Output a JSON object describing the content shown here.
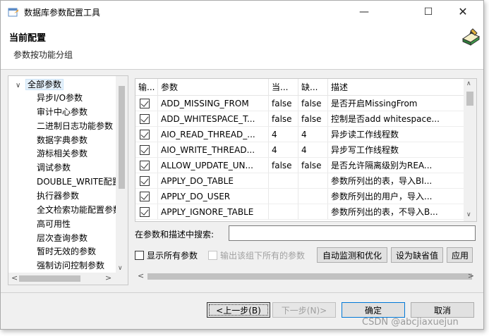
{
  "window": {
    "title": "数据库参数配置工具",
    "controls": {
      "minimize": "—",
      "maximize": "☐",
      "close": "✕"
    }
  },
  "header": {
    "title": "当前配置",
    "subtitle": "参数按功能分组"
  },
  "tree": {
    "root": "全部参数",
    "items": [
      "异步I/O参数",
      "审计中心参数",
      "二进制日志功能参数",
      "数据字典参数",
      "游标相关参数",
      "调试参数",
      "DOUBLE_WRITE配置",
      "执行器参数",
      "全文检索功能配置参数",
      "高可用性",
      "层次查询参数",
      "暂时无效的参数",
      "强制访问控制参数"
    ]
  },
  "table": {
    "columns": [
      "输...",
      "参数",
      "当...",
      "缺...",
      "描述"
    ],
    "rows": [
      {
        "name": "ADD_MISSING_FROM",
        "current": "false",
        "default": "false",
        "desc": "是否开启MissingFrom"
      },
      {
        "name": "ADD_WHITESPACE_T...",
        "current": "false",
        "default": "false",
        "desc": "控制是否add whitespace..."
      },
      {
        "name": "AIO_READ_THREAD_...",
        "current": "4",
        "default": "4",
        "desc": "异步读工作线程数"
      },
      {
        "name": "AIO_WRITE_THREAD...",
        "current": "4",
        "default": "4",
        "desc": "异步写工作线程数"
      },
      {
        "name": "ALLOW_UPDATE_UN...",
        "current": "false",
        "default": "false",
        "desc": "是否允许隔离级别为REA..."
      },
      {
        "name": "APPLY_DO_TABLE",
        "current": "",
        "default": "",
        "desc": "参数所列出的表，导入BI..."
      },
      {
        "name": "APPLY_DO_USER",
        "current": "",
        "default": "",
        "desc": "参数所列出的用户，导入..."
      },
      {
        "name": "APPLY_IGNORE_TABLE",
        "current": "",
        "default": "",
        "desc": "参数所列出的表，不导入B..."
      }
    ]
  },
  "search": {
    "label": "在参数和描述中搜索:",
    "value": ""
  },
  "options": {
    "show_all": "显示所有参数",
    "export_group": "输出该组下所有的参数"
  },
  "buttons": {
    "auto_monitor": "自动监测和优化",
    "set_default": "设为缺省值",
    "apply": "应用",
    "prev": "<上一步(B)",
    "next": "下一步(N)>",
    "ok": "确定",
    "cancel": "取消"
  },
  "watermark": "CSDN @abcjiaxuejun"
}
